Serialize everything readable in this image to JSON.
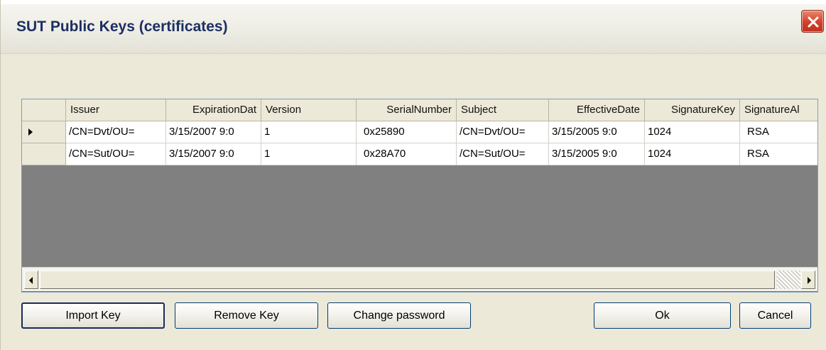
{
  "window": {
    "title": "SUT Public Keys (certificates)",
    "close_icon": "close-icon"
  },
  "grid": {
    "columns": [
      "",
      "Issuer",
      "ExpirationDat",
      "Version",
      "SerialNumber",
      "Subject",
      "EffectiveDate",
      "SignatureKey",
      "SignatureAl"
    ],
    "rows": [
      {
        "selected": true,
        "cells": [
          "/CN=Dvt/OU=",
          "3/15/2007 9:0",
          "1",
          "0x25890",
          "/CN=Dvt/OU=",
          "3/15/2005 9:0",
          "1024",
          "RSA"
        ]
      },
      {
        "selected": false,
        "cells": [
          "/CN=Sut/OU=",
          "3/15/2007 9:0",
          "1",
          "0x28A70",
          "/CN=Sut/OU=",
          "3/15/2005 9:0",
          "1024",
          "RSA"
        ]
      }
    ],
    "selected_row_icon": "row-pointer-icon",
    "colors": {
      "empty_area": "#808080",
      "header_bg": "#ece9d8"
    }
  },
  "buttons": {
    "import_key": "Import Key",
    "remove_key": "Remove Key",
    "change_password": "Change password",
    "ok": "Ok",
    "cancel": "Cancel"
  }
}
